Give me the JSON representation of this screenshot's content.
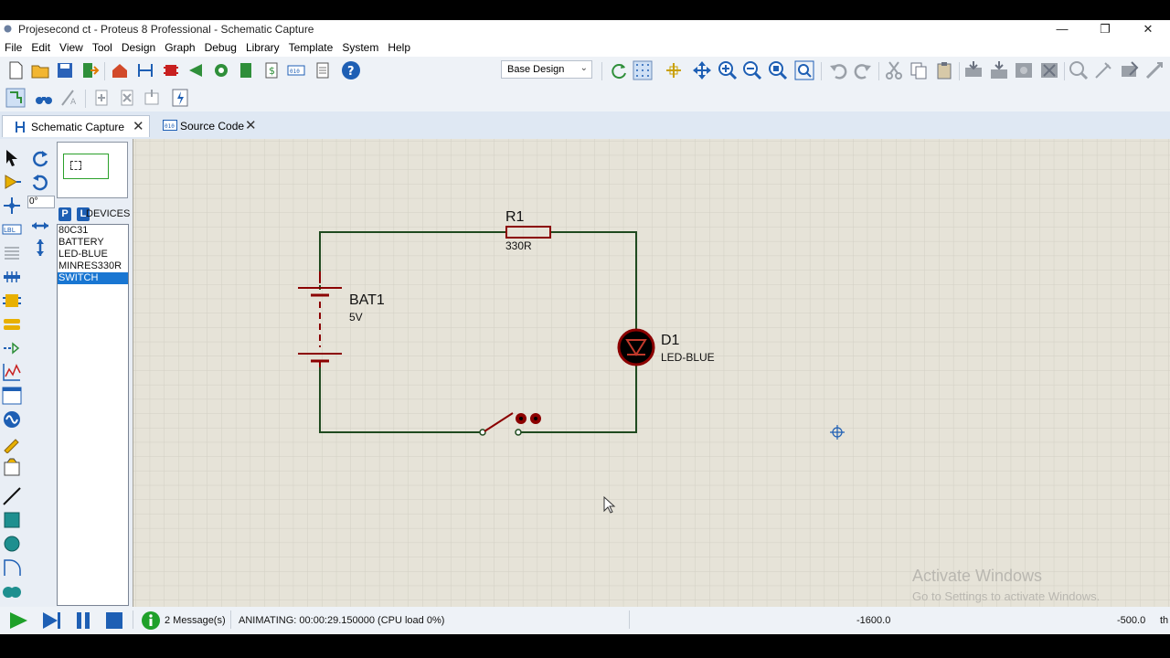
{
  "window": {
    "title": "Projesecond ct - Proteus 8 Professional - Schematic Capture"
  },
  "menu": [
    "File",
    "Edit",
    "View",
    "Tool",
    "Design",
    "Graph",
    "Debug",
    "Library",
    "Template",
    "System",
    "Help"
  ],
  "toolbar": {
    "design_select": "Base Design"
  },
  "tabs": [
    {
      "label": "Schematic Capture"
    },
    {
      "label": "Source Code"
    }
  ],
  "left": {
    "angle": "0°",
    "p_label": "P",
    "l_label": "L",
    "devices_label": "DEVICES",
    "devices": [
      "80C31",
      "BATTERY",
      "LED-BLUE",
      "MINRES330R",
      "SWITCH"
    ],
    "selected_device": "SWITCH"
  },
  "schematic": {
    "battery": {
      "ref": "BAT1",
      "value": "5V"
    },
    "resistor": {
      "ref": "R1",
      "value": "330R"
    },
    "led": {
      "ref": "D1",
      "value": "LED-BLUE"
    }
  },
  "status": {
    "messages": "2 Message(s)",
    "animating": "ANIMATING: 00:00:29.150000 (CPU load 0%)",
    "coord_x": "-1600.0",
    "coord_y": "-500.0",
    "unit": "th"
  },
  "watermark": {
    "line1": "Activate Windows",
    "line2": "Go to Settings to activate Windows."
  },
  "colors": {
    "wire": "#1f4a1f",
    "component": "#8b0000",
    "canvas": "#e6e3d8",
    "grid": "#d2cfc4",
    "selection": "#1976d2"
  }
}
